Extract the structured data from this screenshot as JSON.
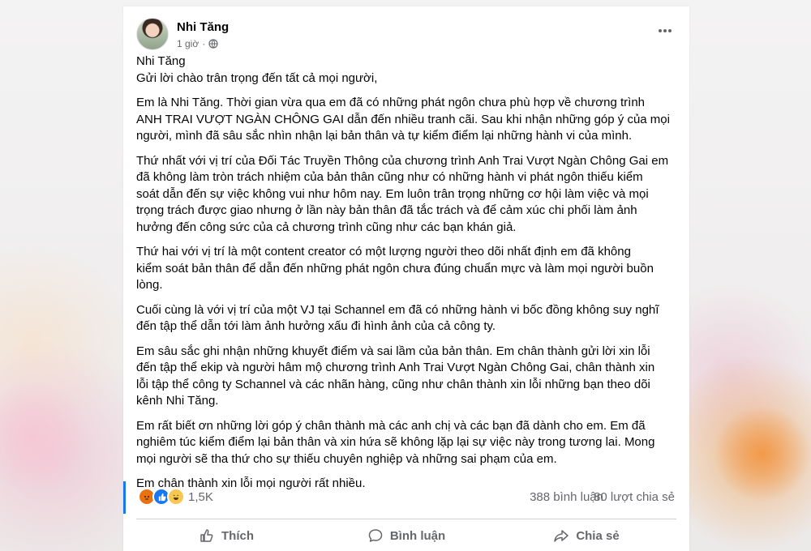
{
  "post": {
    "author": "Nhi Tăng",
    "time": "1 giờ",
    "privacy_icon": "globe-icon",
    "more_icon": "more-icon",
    "lines": [
      "Nhi Tăng",
      "Gửi lời chào trân trọng đến tất cả mọi người,"
    ],
    "paragraphs": [
      [
        "Em là Nhi Tăng. Thời gian vừa qua em đã có những phát ngôn chưa phù hợp  về chương trình",
        "ANH TRAI VƯỢT NGÀN CHÔNG GAI dẫn đến nhiều tranh cãi. Sau khi nhận những góp ý của mọi",
        "người, mình đã sâu sắc nhìn nhận lại bản thân và tự kiểm điểm lại những hành vi của mình."
      ],
      [
        "Thứ nhất với vị trí của Đối Tác Truyền Thông của chương trình Anh Trai Vượt Ngàn Chông Gai em",
        "đã không làm tròn trách nhiệm của bản thân cũng như có những hành vi phát ngôn thiếu kiểm",
        "soát dẫn đến sự việc không vui như hôm nay. Em luôn trân trọng những cơ hội làm việc và mọi",
        "trọng trách được giao nhưng ở lần này bản thân đã tắc trách và để cảm xúc chi phối làm ảnh",
        "hưởng đến công sức của cả chương trình cũng như các bạn khán giả."
      ],
      [
        "Thứ hai với vị trí là một content creator có một lượng người theo dõi nhất định em đã không",
        "kiểm soát bản thân để dẫn đến những phát ngôn chưa đúng chuẩn mực và làm mọi người buồn",
        "lòng."
      ],
      [
        "Cuối cùng là với vị trí của một VJ tại Schannel em đã có những hành vi bốc đồng không suy nghĩ",
        "đến tập thể dẫn tới làm ảnh hưởng xấu đi hình ảnh của cả công ty."
      ],
      [
        "Em sâu sắc ghi nhận những khuyết điểm và sai lầm của bản thân. Em chân thành gửi lời xin lỗi",
        "đến tập thể ekip và người hâm mộ chương trình Anh Trai Vượt Ngàn Chông Gai, chân thành xin",
        "lỗi tập thể công ty Schannel và các nhãn hàng, cũng như chân thành xin lỗi những bạn theo dõi",
        "kênh Nhi Tăng."
      ],
      [
        "Em rất biết ơn những lời góp ý chân thành mà các anh chị và các bạn đã dành cho em. Em đã",
        "nghiêm túc kiểm điểm lại bản thân và xin hứa sẽ không lặp lại sự việc này trong tương lai. Mong",
        "mọi người sẽ tha thứ cho sự thiếu chuyên nghiệp và những sai phạm của em."
      ],
      [
        "Em chân thành xin lỗi mọi người rất nhiều."
      ]
    ]
  },
  "stats": {
    "reaction_icons": [
      "angry-icon",
      "like-icon",
      "haha-icon"
    ],
    "reaction_count": "1,5K",
    "comments": "388 bình luận",
    "shares": "80 lượt chia sẻ"
  },
  "actions": {
    "like": "Thích",
    "comment": "Bình luận",
    "share": "Chia sẻ"
  },
  "colors": {
    "accent": "#1877f2",
    "text": "#050505",
    "muted": "#65676b"
  }
}
